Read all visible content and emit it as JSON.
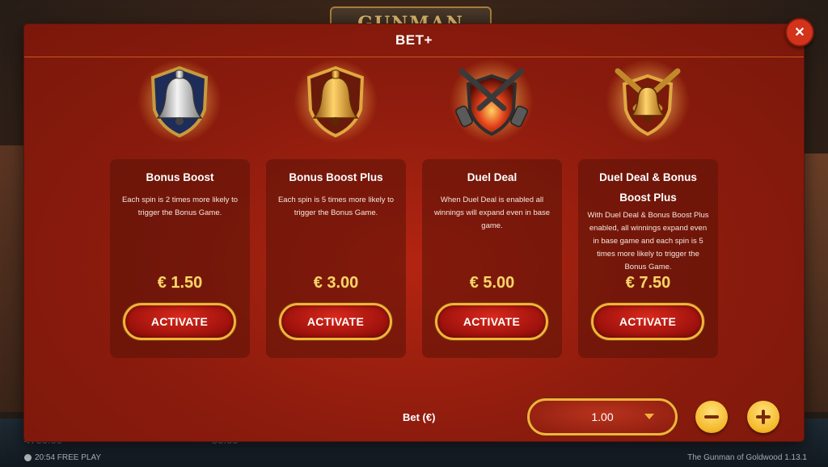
{
  "window": {
    "title": "BET+"
  },
  "background": {
    "logo_text": "GUNMAN",
    "value_left": "4700.00",
    "value_mid": "50.00",
    "clock": "20:54 FREE PLAY",
    "game_name": "The Gunman of Goldwood  1.13.1"
  },
  "cards": [
    {
      "title": "Bonus Boost",
      "description": "Each spin is 2 times more likely to trigger the Bonus Game.",
      "price": "€ 1.50",
      "button_label": "ACTIVATE",
      "icon": "silver-bell-icon"
    },
    {
      "title": "Bonus Boost Plus",
      "description": "Each spin is 5 times more likely to trigger the Bonus Game.",
      "price": "€ 3.00",
      "button_label": "ACTIVATE",
      "icon": "gold-bell-icon"
    },
    {
      "title": "Duel Deal",
      "description": "When Duel Deal is enabled all winnings will expand even in base game.",
      "price": "€ 5.00",
      "button_label": "ACTIVATE",
      "icon": "crossed-revolvers-icon"
    },
    {
      "title": "Duel Deal & Bonus Boost Plus",
      "description": "With Duel Deal & Bonus Boost Plus enabled, all winnings expand even in base game and each spin is 5 times more likely to trigger the Bonus Game.",
      "price": "€ 7.50",
      "button_label": "ACTIVATE",
      "icon": "bell-with-revolvers-icon"
    }
  ],
  "bet": {
    "label": "Bet (€)",
    "selected_value": "1.00"
  },
  "colors": {
    "modal_red": "#9a1f0f",
    "gold_accent": "#f0b43a",
    "price_gold": "#ffd36a",
    "button_red": "#9e120c"
  }
}
